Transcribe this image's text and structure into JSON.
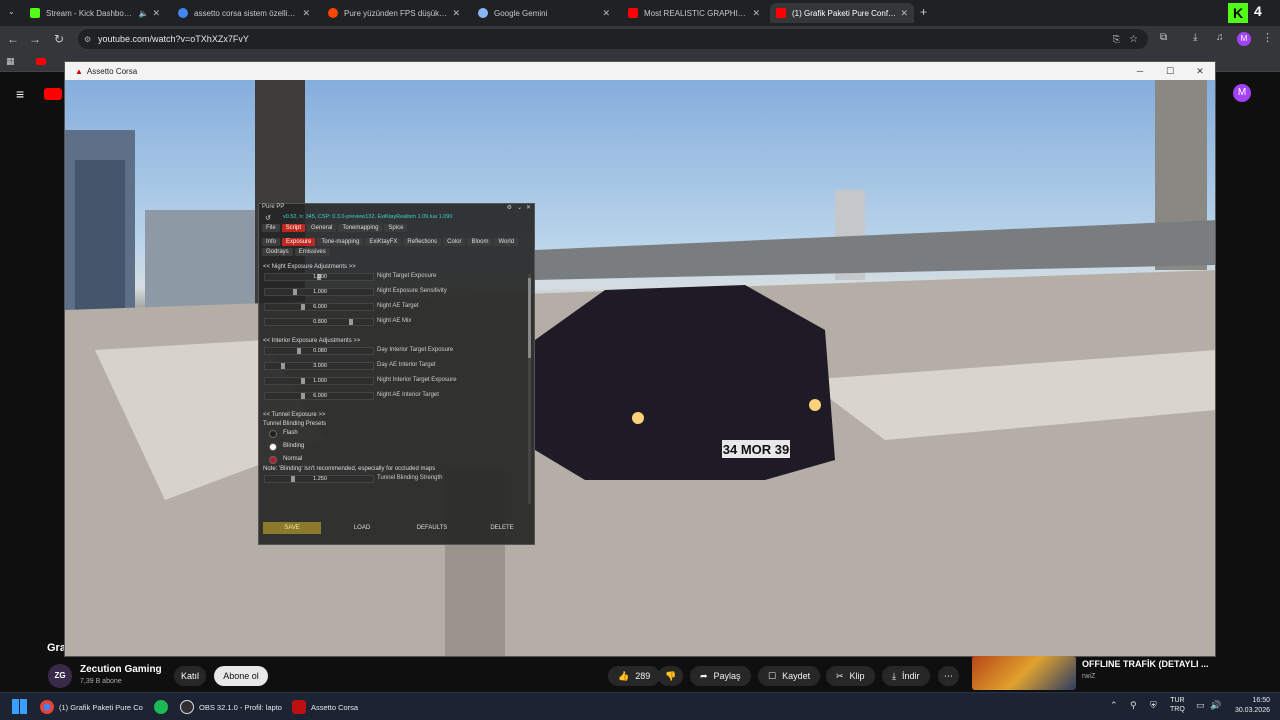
{
  "browser": {
    "tabs": [
      {
        "label": "Stream - Kick Dashboard",
        "color": "#53fc18"
      },
      {
        "label": "assetto corsa sistem özellikleri",
        "color": "#4285f4"
      },
      {
        "label": "Pure yüzünden FPS düşük. : r/a",
        "color": "#ff4500"
      },
      {
        "label": "Google Gemini",
        "color": "#8ab4f8"
      },
      {
        "label": "Most REALISTIC GRAPHICS You",
        "color": "#ff0000"
      },
      {
        "label": "(1) Grafik Paketi Pure Config G",
        "color": "#ff0000"
      }
    ],
    "url": "youtube.com/watch?v=oTXhXZx7FvY"
  },
  "game": {
    "window_title": "Assetto Corsa",
    "plate": "34 MOR 39"
  },
  "panel": {
    "title": "Pure PP",
    "version": "v0.52, n: 345, CSP: 0.3.0-preview132, ExiKtayRealism 1.09.lua 1.090",
    "menu": [
      "File",
      "Script",
      "General",
      "Tonemapping",
      "Spice"
    ],
    "subtabs": [
      "Info",
      "Exposure",
      "Tone-mapping",
      "ExiKtayFX",
      "Reflections",
      "Color",
      "Bloom",
      "World"
    ],
    "subtabs2": [
      "Godrays",
      "Emissives"
    ],
    "sec_night": "<< Night Exposure Adjustments >>",
    "night": [
      {
        "value": "1.000",
        "label": "Night Target Exposure"
      },
      {
        "value": "1.000",
        "label": "Night Exposure Sensitivity"
      },
      {
        "value": "6.000",
        "label": "Night AE Target"
      },
      {
        "value": "0.800",
        "label": "Night AE Mix"
      }
    ],
    "sec_interior": "<< Interior Exposure Adjustments >>",
    "interior": [
      {
        "value": "0.080",
        "label": "Day Interior Target Exposure"
      },
      {
        "value": "3.000",
        "label": "Day AE Interior Target"
      },
      {
        "value": "1.000",
        "label": "Night Interior Target Exposure"
      },
      {
        "value": "6.000",
        "label": "Night AE Interior Target"
      }
    ],
    "sec_tunnel": "<< Tunnel Exposure >>",
    "presets_label": "Tunnel Blinding Presets",
    "presets": [
      "Flash",
      "Blinding",
      "Normal"
    ],
    "note": "Note: 'Blinding' isn't recommended, especially for occluded maps",
    "strength": {
      "value": "1.250",
      "label": "Tunnel Blinding Strength"
    },
    "buttons": {
      "save": "SAVE",
      "load": "LOAD",
      "defaults": "DEFAULTS",
      "delete": "DELETE"
    }
  },
  "youtube": {
    "channel": "Zecution Gaming",
    "subscribers": "7,39 B abone",
    "join": "Katıl",
    "subscribe": "Abone ol",
    "likes": "289",
    "share": "Paylaş",
    "save": "Kaydet",
    "clip": "Klip",
    "download": "İndir",
    "suggest_title": "OFFLINE TRAFİK (DETAYLI ...",
    "suggest_channel": "rwiZ",
    "avatar_letter": "M",
    "title_peek": "Gra"
  },
  "taskbar": {
    "items": [
      "(1) Grafik Paketi Pure Co",
      "OBS 32.1.0 - Profil: lapto",
      "Assetto Corsa"
    ],
    "lang": "TUR",
    "lang2": "TRQ",
    "time": "16:50",
    "date": "30.03.2026"
  }
}
